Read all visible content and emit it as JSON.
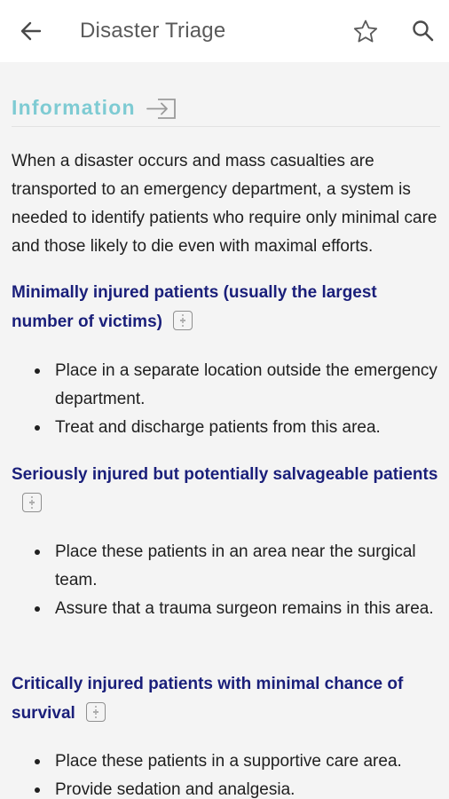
{
  "appbar": {
    "title": "Disaster Triage",
    "back_icon": "arrow-left-icon",
    "favorite_icon": "star-outline-icon",
    "search_icon": "search-icon"
  },
  "section": {
    "label": "Information",
    "icon": "enter-icon",
    "accent": "#7ecbd3"
  },
  "intro": "When a disaster occurs and mass casualties are transported to an emergency department, a system is needed to identify patients who require only minimal care and those likely to die even with maximal efforts.",
  "groups": [
    {
      "heading": "Minimally injured patients (usually the largest number of victims)",
      "items": [
        "Place in a separate location outside the emergency department.",
        "Treat and discharge patients from this area."
      ]
    },
    {
      "heading": "Seriously injured but potentially salvageable patients",
      "items": [
        "Place these patients in an area near the surgical team.",
        "Assure that a trauma surgeon remains in this area."
      ]
    },
    {
      "heading": "Critically injured patients with minimal chance of survival",
      "items": [
        "Place these patients in a supportive care area.",
        "Provide sedation and analgesia."
      ]
    }
  ],
  "colors": {
    "heading": "#1a1f7a",
    "text": "#202020",
    "background": "#f4f4f4"
  }
}
